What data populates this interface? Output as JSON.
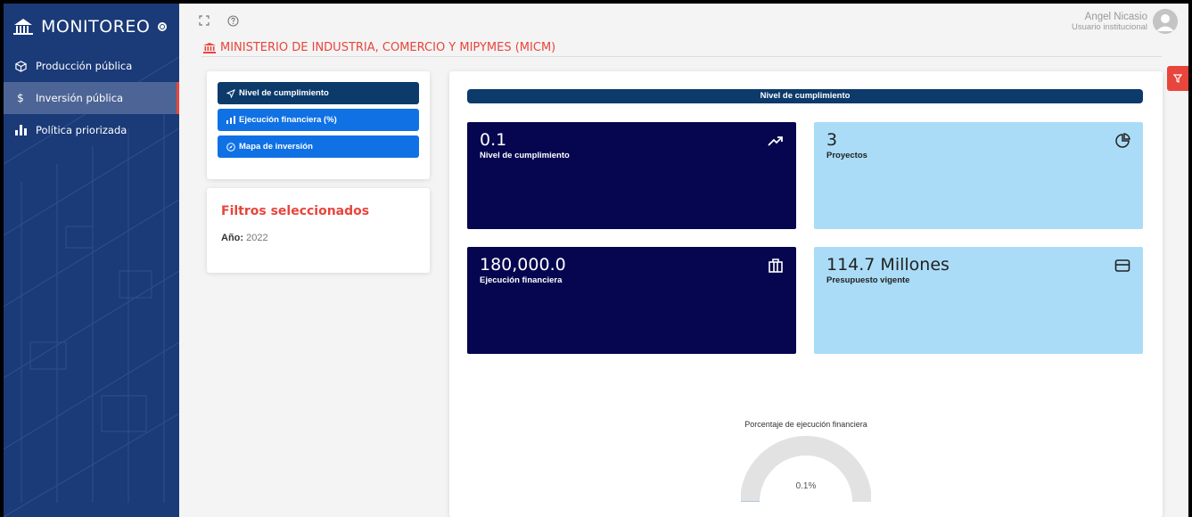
{
  "sidebar": {
    "brand": "MONITOREO",
    "items": [
      {
        "label": "Producción pública",
        "icon": "cube-icon"
      },
      {
        "label": "Inversión pública",
        "icon": "dollar-icon"
      },
      {
        "label": "Política priorizada",
        "icon": "bar-chart-icon"
      }
    ]
  },
  "user": {
    "name": "Angel Nicasio",
    "role": "Usuario institucional"
  },
  "ministry": "MINISTERIO DE INDUSTRIA, COMERCIO Y MIPYMES (MICM)",
  "nav_buttons": [
    {
      "label": "Nivel de cumplimiento",
      "icon": "send-icon"
    },
    {
      "label": "Ejecución financiera (%)",
      "icon": "bar-chart-icon"
    },
    {
      "label": "Mapa de inversión",
      "icon": "compass-icon"
    }
  ],
  "filters": {
    "title": "Filtros seleccionados",
    "year_label": "Año:",
    "year_value": "2022"
  },
  "main": {
    "header": "Nivel de cumplimiento",
    "tiles": [
      {
        "value": "0.1",
        "label": "Nivel de cumplimiento",
        "icon": "trending-up-icon"
      },
      {
        "value": "3",
        "label": "Proyectos",
        "icon": "pie-chart-icon"
      },
      {
        "value": "180,000.0",
        "label": "Ejecución financiera",
        "icon": "briefcase-icon"
      },
      {
        "value": "114.7 Millones",
        "label": "Presupuesto vigente",
        "icon": "credit-card-icon"
      }
    ],
    "gauge": {
      "title": "Porcentaje de ejecución financiera",
      "value_label": "0.1%",
      "percent": 0.1
    }
  },
  "colors": {
    "sidebar": "#1a3a78",
    "accent": "#e8453c",
    "primary": "#0c3a6b",
    "secondary": "#1071e5",
    "tile_dark": "#05064f",
    "tile_light": "#aadcf7"
  }
}
